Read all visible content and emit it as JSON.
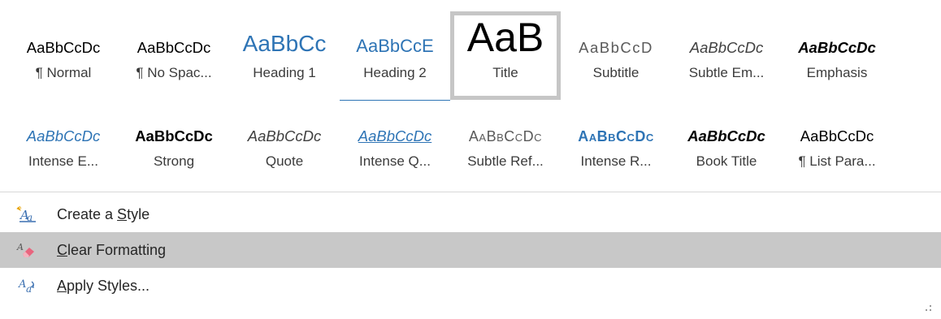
{
  "styles_row1": [
    {
      "sample": "AaBbCcDc",
      "label": "¶ Normal"
    },
    {
      "sample": "AaBbCcDc",
      "label": "¶ No Spac..."
    },
    {
      "sample": "AaBbCc",
      "label": "Heading 1"
    },
    {
      "sample": "AaBbCcE",
      "label": "Heading 2"
    },
    {
      "sample": "AaB",
      "label": "Title"
    },
    {
      "sample": "AaBbCcD",
      "label": "Subtitle"
    },
    {
      "sample": "AaBbCcDc",
      "label": "Subtle Em..."
    },
    {
      "sample": "AaBbCcDc",
      "label": "Emphasis"
    }
  ],
  "styles_row2": [
    {
      "sample": "AaBbCcDc",
      "label": "Intense E..."
    },
    {
      "sample": "AaBbCcDc",
      "label": "Strong"
    },
    {
      "sample": "AaBbCcDc",
      "label": "Quote"
    },
    {
      "sample": "AaBbCcDc",
      "label": "Intense Q..."
    },
    {
      "sample": "AaBbCcDc",
      "label": "Subtle Ref..."
    },
    {
      "sample": "AaBbCcDc",
      "label": "Intense R..."
    },
    {
      "sample": "AaBbCcDc",
      "label": "Book Title"
    },
    {
      "sample": "AaBbCcDc",
      "label": "¶ List Para..."
    }
  ],
  "selected_style": "Title",
  "menu": {
    "create_style": {
      "pre": "Create a ",
      "accel": "S",
      "post": "tyle",
      "icon": "create-style-icon"
    },
    "clear_formatting": {
      "pre": "",
      "accel": "C",
      "post": "lear Formatting",
      "icon": "eraser-icon"
    },
    "apply_styles": {
      "pre": "",
      "accel": "A",
      "post": "pply Styles...",
      "icon": "apply-styles-icon"
    }
  },
  "colors": {
    "heading_blue": "#2e74b5",
    "hover_bg": "#c8c8c8",
    "selected_border": "#c6c6c6"
  }
}
